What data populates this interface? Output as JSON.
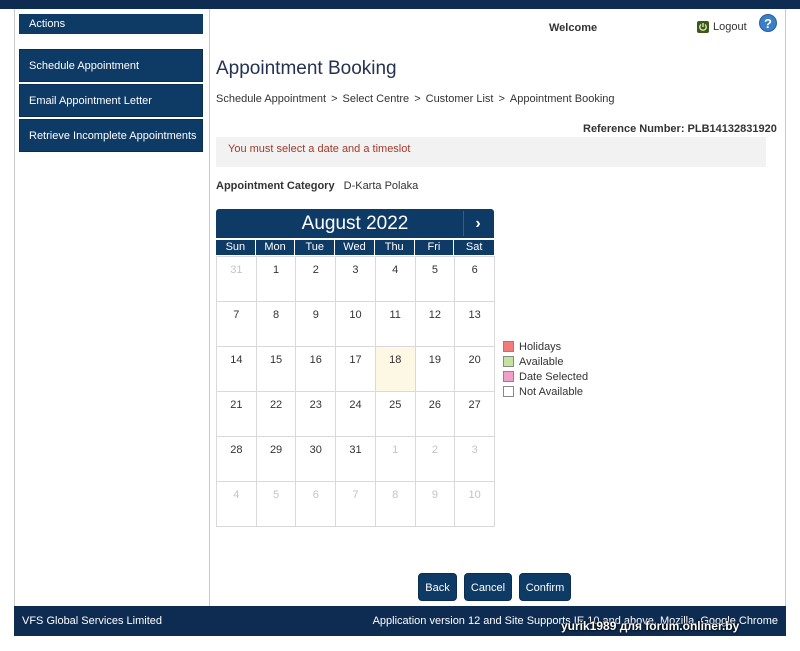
{
  "sidebar": {
    "header": "Actions",
    "items": [
      {
        "label": "Schedule Appointment"
      },
      {
        "label": "Email Appointment Letter"
      },
      {
        "label": "Retrieve Incomplete Appointments"
      }
    ]
  },
  "header": {
    "welcome": "Welcome",
    "logout": "Logout",
    "help": "?"
  },
  "main": {
    "title": "Appointment Booking",
    "breadcrumb": [
      "Schedule Appointment",
      "Select Centre",
      "Customer List",
      "Appointment Booking"
    ],
    "breadcrumb_sep": ">",
    "reference": "Reference Number: PLB14132831920",
    "error": "You must select a date and a timeslot",
    "category_label": "Appointment Category",
    "category_value": "D-Karta Polaka"
  },
  "calendar": {
    "month": "August 2022",
    "next": "›",
    "weekdays": [
      "Sun",
      "Mon",
      "Tue",
      "Wed",
      "Thu",
      "Fri",
      "Sat"
    ],
    "today": "18",
    "days": [
      {
        "d": "31",
        "other": true
      },
      {
        "d": "1"
      },
      {
        "d": "2"
      },
      {
        "d": "3"
      },
      {
        "d": "4"
      },
      {
        "d": "5"
      },
      {
        "d": "6"
      },
      {
        "d": "7"
      },
      {
        "d": "8"
      },
      {
        "d": "9"
      },
      {
        "d": "10"
      },
      {
        "d": "11"
      },
      {
        "d": "12"
      },
      {
        "d": "13"
      },
      {
        "d": "14"
      },
      {
        "d": "15"
      },
      {
        "d": "16"
      },
      {
        "d": "17"
      },
      {
        "d": "18"
      },
      {
        "d": "19"
      },
      {
        "d": "20"
      },
      {
        "d": "21"
      },
      {
        "d": "22"
      },
      {
        "d": "23"
      },
      {
        "d": "24"
      },
      {
        "d": "25"
      },
      {
        "d": "26"
      },
      {
        "d": "27"
      },
      {
        "d": "28"
      },
      {
        "d": "29"
      },
      {
        "d": "30"
      },
      {
        "d": "31"
      },
      {
        "d": "1",
        "other": true
      },
      {
        "d": "2",
        "other": true
      },
      {
        "d": "3",
        "other": true
      },
      {
        "d": "4",
        "other": true
      },
      {
        "d": "5",
        "other": true
      },
      {
        "d": "6",
        "other": true
      },
      {
        "d": "7",
        "other": true
      },
      {
        "d": "8",
        "other": true
      },
      {
        "d": "9",
        "other": true
      },
      {
        "d": "10",
        "other": true
      }
    ]
  },
  "legend": [
    {
      "label": "Holidays",
      "color": "#f27c7c"
    },
    {
      "label": "Available",
      "color": "#c5e3a0"
    },
    {
      "label": "Date Selected",
      "color": "#f0a0c8"
    },
    {
      "label": "Not Available",
      "color": "#ffffff"
    }
  ],
  "buttons": {
    "back": "Back",
    "cancel": "Cancel",
    "confirm": "Confirm"
  },
  "footer": {
    "left": "VFS Global Services Limited",
    "right": "Application version 12 and Site Supports IE 10 and above, Mozilla, Google Chrome"
  },
  "watermark": "yurik1989 для forum.onliner.by"
}
